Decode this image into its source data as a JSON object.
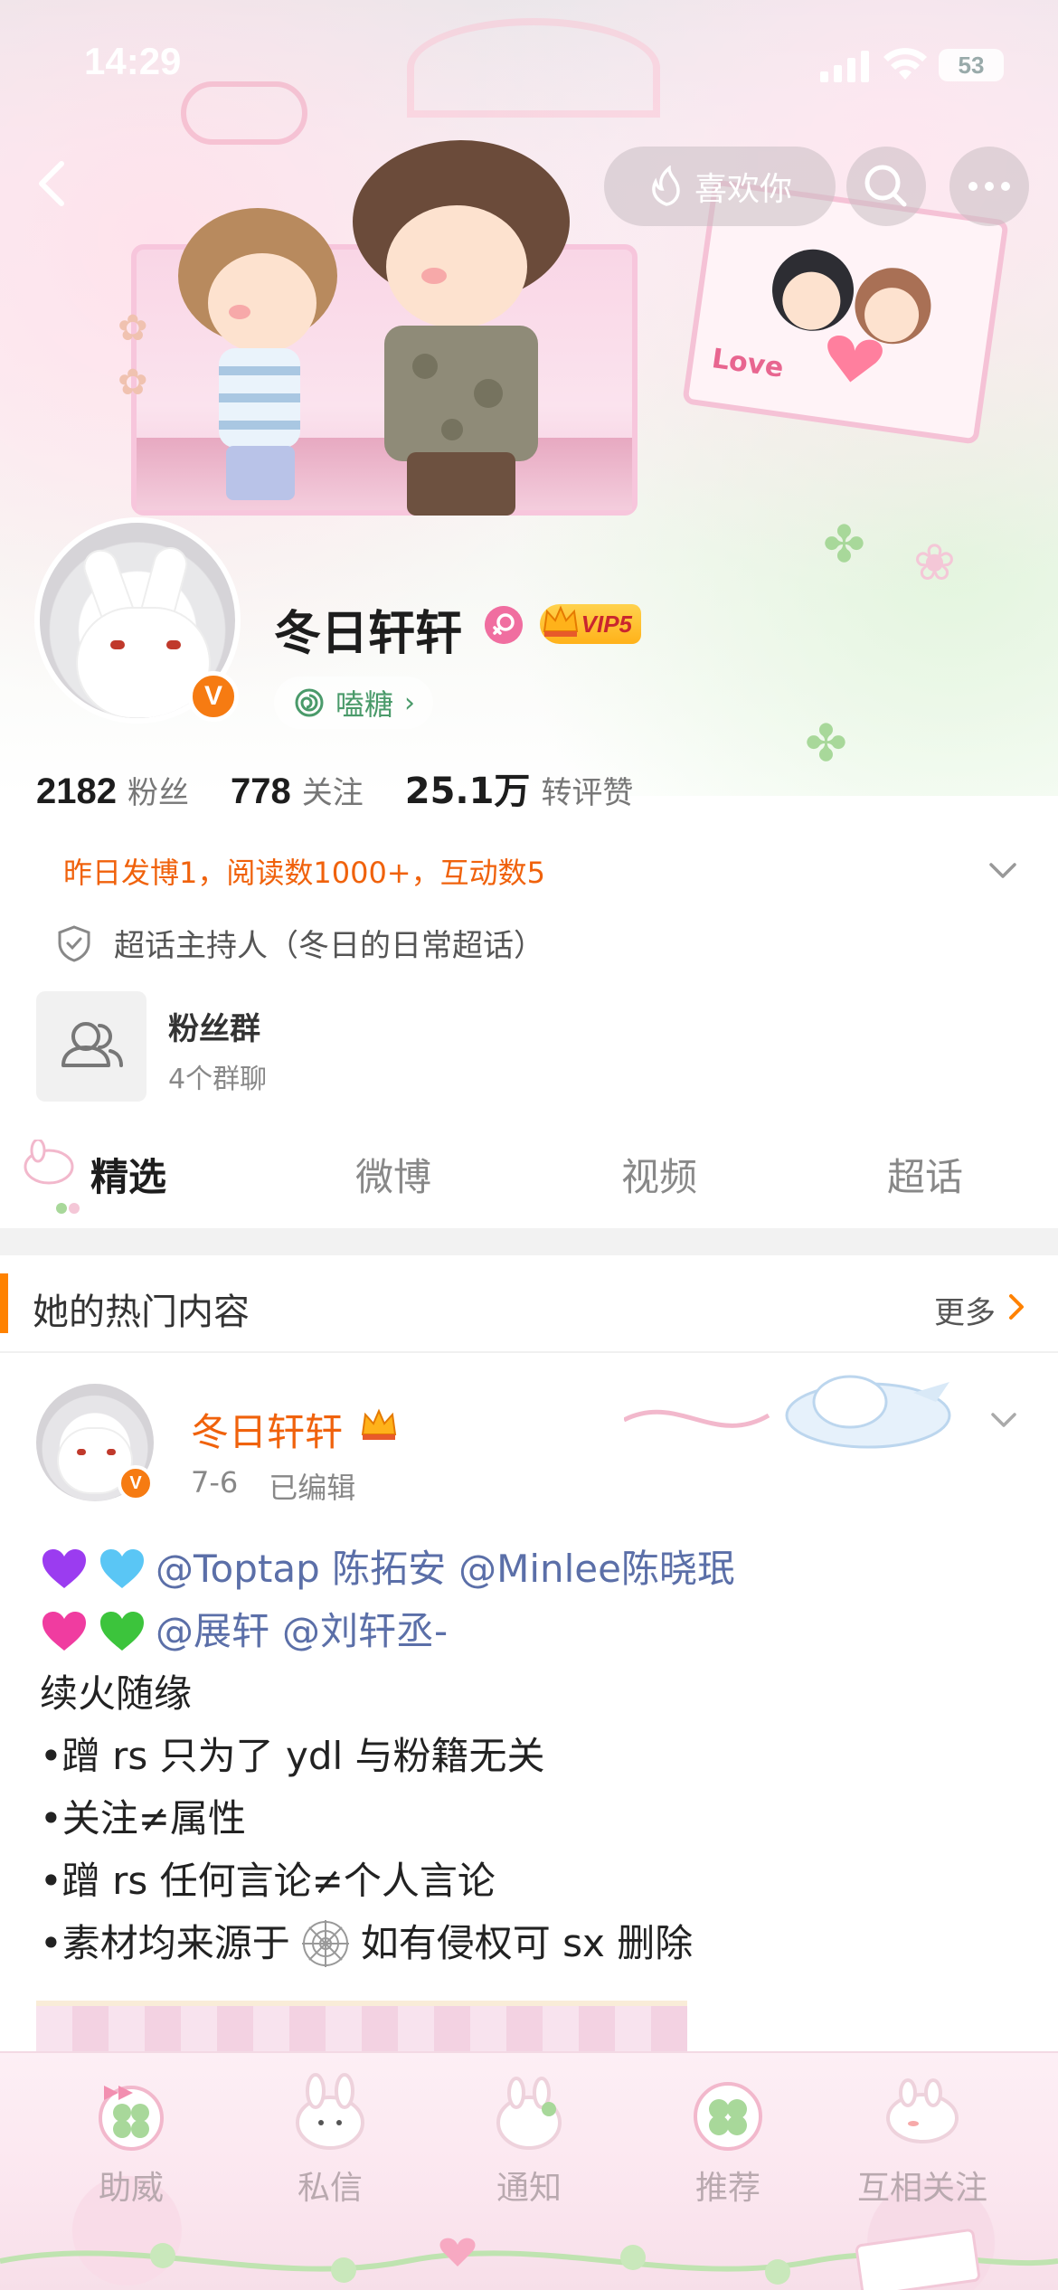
{
  "status_bar": {
    "time": "14:29",
    "battery": "53"
  },
  "nav": {
    "like_label": "喜欢你"
  },
  "profile": {
    "username": "冬日轩轩",
    "vip": "VIP5",
    "group_name": "嗑糖",
    "group_chevron": "›",
    "verified_mark": "V",
    "stats": [
      {
        "value": "2182",
        "label": "粉丝"
      },
      {
        "value": "778",
        "label": "关注"
      },
      {
        "value": "25.1万",
        "label": "转评赞"
      }
    ],
    "yesterday_summary": "昨日发博1，阅读数1000+，互动数5",
    "host_role": "超话主持人（冬日的日常超话）",
    "fan_group": {
      "title": "粉丝群",
      "subtitle": "4个群聊"
    }
  },
  "tabs": [
    {
      "label": "精选",
      "active": true
    },
    {
      "label": "微博",
      "active": false
    },
    {
      "label": "视频",
      "active": false
    },
    {
      "label": "超话",
      "active": false
    }
  ],
  "hot_section": {
    "title": "她的热门内容",
    "more_label": "更多"
  },
  "post": {
    "author": "冬日轩轩",
    "date": "7-6",
    "edited": "已编辑",
    "line1_mentions": [
      "@Toptap 陈拓安",
      "@Minlee陈晓珉"
    ],
    "line2_mentions": [
      "@展轩",
      "@刘轩丞-"
    ],
    "line3": "续火随缘",
    "line4": "•蹭 rs 只为了 ydl 与粉籍无关",
    "line5": "•关注≠属性",
    "line6": "•蹭 rs 任何言论≠个人言论",
    "line7_prefix": "•素材均来源于",
    "line7_suffix": "如有侵权可 sx 删除"
  },
  "bottom_bar": {
    "items": [
      {
        "label": "助威",
        "icon": "clover-bow-icon"
      },
      {
        "label": "私信",
        "icon": "bunny-message-icon"
      },
      {
        "label": "通知",
        "icon": "bunny-bell-icon"
      },
      {
        "label": "推荐",
        "icon": "clover-recommend-icon"
      },
      {
        "label": "互相关注",
        "icon": "bunny-follow-icon"
      }
    ]
  },
  "colors": {
    "accent_orange": "#ff8200",
    "name_orange": "#f0620c",
    "mention_blue": "#5b6fa8",
    "verified_orange": "#f67b12",
    "vip_gold": "#ffc233"
  }
}
